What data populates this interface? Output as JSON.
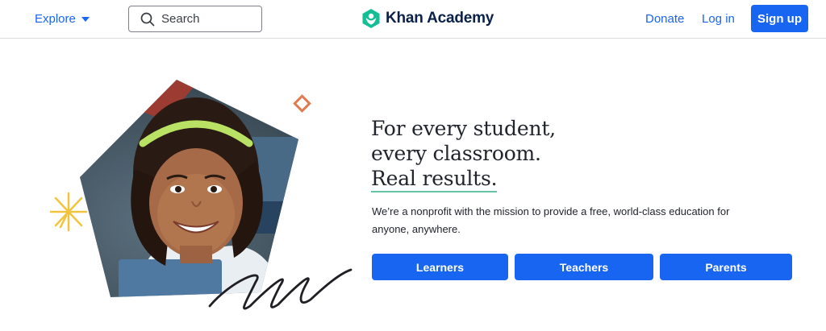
{
  "header": {
    "explore_label": "Explore",
    "search_label": "Search",
    "logo_text": "Khan Academy",
    "donate_label": "Donate",
    "login_label": "Log in",
    "signup_label": "Sign up"
  },
  "hero": {
    "headline_line1": "For every student,",
    "headline_line2": "every classroom.",
    "headline_line3": "Real results.",
    "mission_text": "We’re a nonprofit with the mission to provide a free, world-class education for anyone, anywhere.",
    "buttons": [
      {
        "label": "Learners"
      },
      {
        "label": "Teachers"
      },
      {
        "label": "Parents"
      }
    ]
  },
  "colors": {
    "brand_blue": "#1865f2",
    "brand_green": "#14bf96",
    "text_dark": "#21242c",
    "accent_orange": "#e07a4f",
    "accent_yellow": "#f2c43d"
  },
  "icons": [
    "chevron-down-icon",
    "search-icon",
    "khan-logo-icon",
    "sparkle-icon",
    "diamond-icon",
    "squiggle-decoration"
  ]
}
